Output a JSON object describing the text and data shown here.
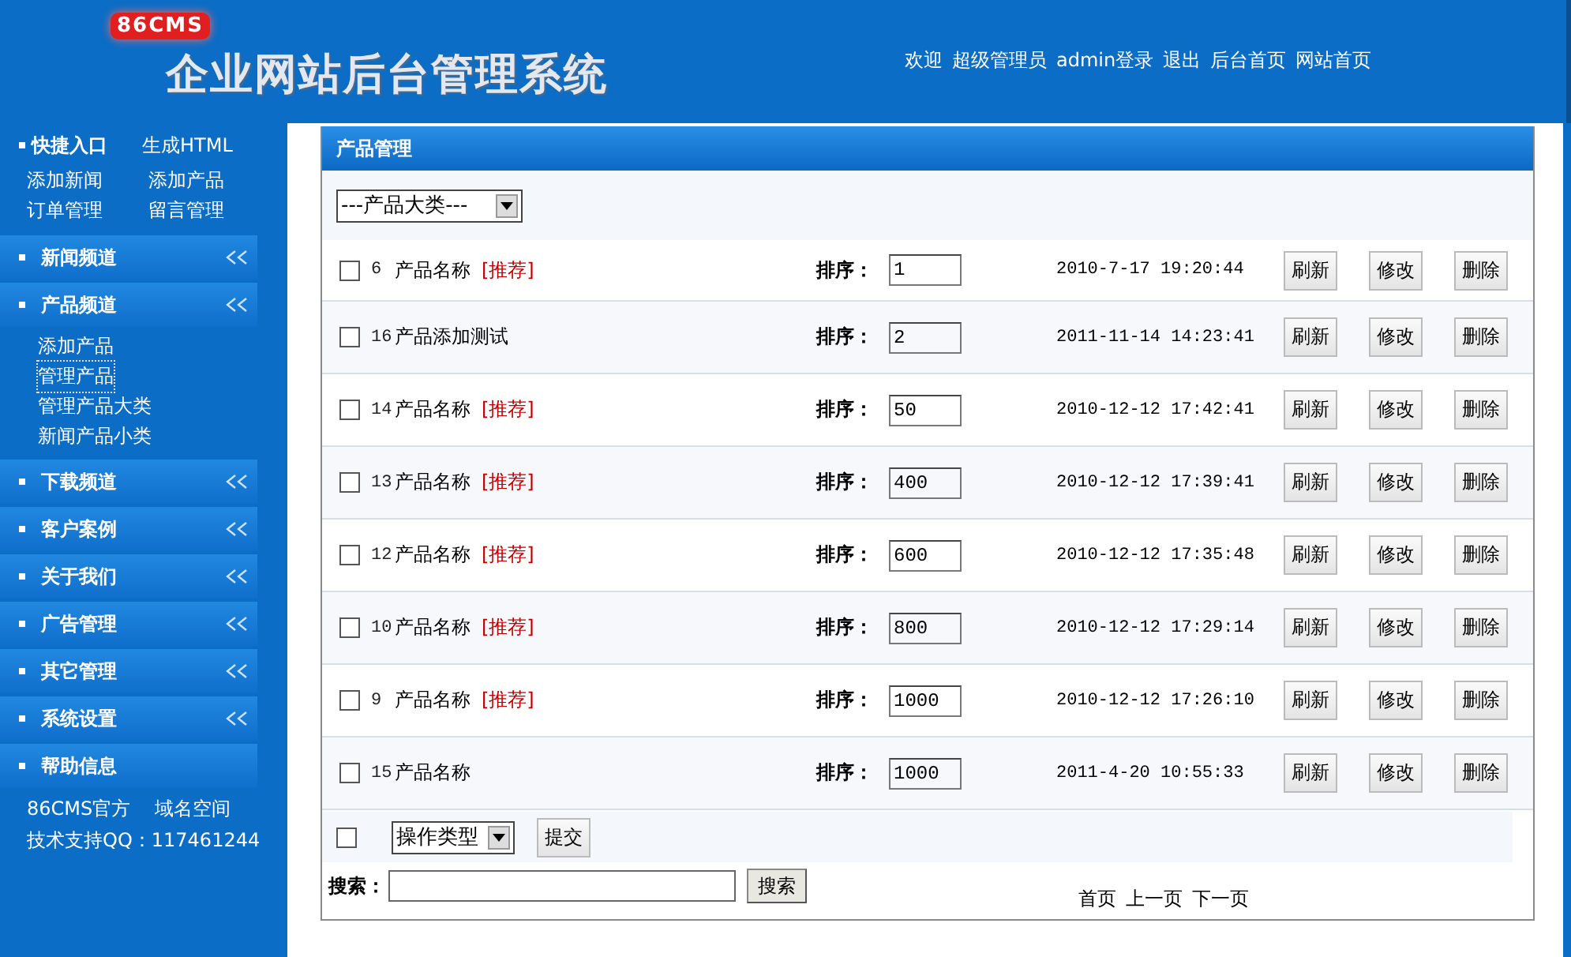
{
  "header": {
    "logo": "86CMS",
    "title": "企业网站后台管理系统",
    "links": [
      "欢迎",
      "超级管理员",
      "admin登录",
      "退出",
      "后台首页",
      "网站首页"
    ]
  },
  "sidebar": {
    "quick": {
      "title": "快捷入口",
      "links": [
        "生成HTML",
        "添加新闻",
        "添加产品",
        "订单管理",
        "留言管理"
      ]
    },
    "sections": [
      {
        "kind": "menu",
        "title": "新闻频道"
      },
      {
        "kind": "menu",
        "title": "产品频道",
        "items": [
          {
            "label": "添加产品",
            "selected": false
          },
          {
            "label": "管理产品",
            "selected": true
          },
          {
            "label": "管理产品大类",
            "selected": false
          },
          {
            "label": "新闻产品小类",
            "selected": false
          }
        ]
      },
      {
        "kind": "menu",
        "title": "下载频道"
      },
      {
        "kind": "menu",
        "title": "客户案例"
      },
      {
        "kind": "menu",
        "title": "关于我们"
      },
      {
        "kind": "menu",
        "title": "广告管理"
      },
      {
        "kind": "menu",
        "title": "其它管理"
      },
      {
        "kind": "menu",
        "title": "系统设置"
      },
      {
        "kind": "info",
        "title": "帮助信息",
        "items": [
          {
            "label": "86CMS官方",
            "selected": false
          },
          {
            "label": "域名空间",
            "selected": false
          },
          {
            "label": "技术支持QQ：117461244",
            "selected": false
          }
        ]
      }
    ]
  },
  "panel": {
    "title": "产品管理",
    "category_select": "---产品大类---",
    "rows": [
      {
        "checked": false,
        "id": "6",
        "name": "产品名称",
        "tag": "[推荐]",
        "sort_label": "排序：",
        "sort": "1",
        "date": "2010-7-17 19:20:44",
        "buttons": [
          "刷新",
          "修改",
          "删除"
        ]
      },
      {
        "checked": false,
        "id": "16",
        "name": "产品添加测试",
        "sort_label": "排序：",
        "sort": "2",
        "date": "2011-11-14 14:23:41",
        "buttons": [
          "刷新",
          "修改",
          "删除"
        ]
      },
      {
        "checked": false,
        "id": "14",
        "name": "产品名称",
        "tag": "[推荐]",
        "sort_label": "排序：",
        "sort": "50",
        "date": "2010-12-12 17:42:41",
        "buttons": [
          "刷新",
          "修改",
          "删除"
        ]
      },
      {
        "checked": false,
        "id": "13",
        "name": "产品名称",
        "tag": "[推荐]",
        "sort_label": "排序：",
        "sort": "400",
        "date": "2010-12-12 17:39:41",
        "buttons": [
          "刷新",
          "修改",
          "删除"
        ]
      },
      {
        "checked": false,
        "id": "12",
        "name": "产品名称",
        "tag": "[推荐]",
        "sort_label": "排序：",
        "sort": "600",
        "date": "2010-12-12 17:35:48",
        "buttons": [
          "刷新",
          "修改",
          "删除"
        ]
      },
      {
        "checked": false,
        "id": "10",
        "name": "产品名称",
        "tag": "[推荐]",
        "sort_label": "排序：",
        "sort": "800",
        "date": "2010-12-12 17:29:14",
        "buttons": [
          "刷新",
          "修改",
          "删除"
        ]
      },
      {
        "checked": false,
        "id": "9",
        "name": "产品名称",
        "tag": "[推荐]",
        "sort_label": "排序：",
        "sort": "1000",
        "date": "2010-12-12 17:26:10",
        "buttons": [
          "刷新",
          "修改",
          "删除"
        ]
      },
      {
        "checked": false,
        "id": "15",
        "name": "产品名称",
        "sort_label": "排序：",
        "sort": "1000",
        "date": "2011-4-20 10:55:33",
        "buttons": [
          "刷新",
          "修改",
          "删除"
        ]
      }
    ],
    "bulk": {
      "checked": false,
      "action_select": "操作类型",
      "submit": "提交"
    },
    "search": {
      "label": "搜索：",
      "button": "搜索"
    },
    "pagination": [
      "首页",
      "上一页",
      "下一页"
    ]
  }
}
